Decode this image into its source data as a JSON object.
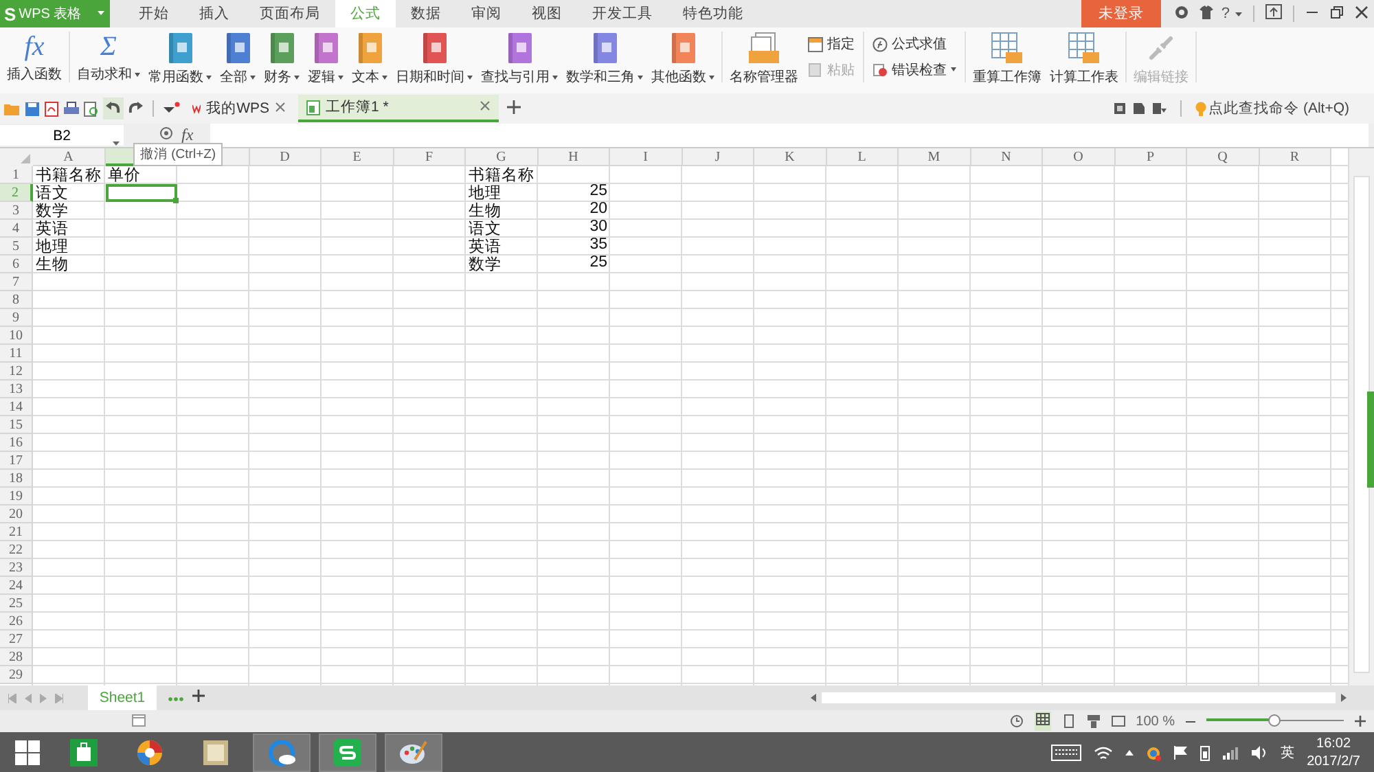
{
  "app_button": {
    "logo": "S",
    "label": "WPS 表格"
  },
  "menu_tabs": [
    {
      "label": "开始",
      "selected": false
    },
    {
      "label": "插入",
      "selected": false
    },
    {
      "label": "页面布局",
      "selected": false
    },
    {
      "label": "公式",
      "selected": true
    },
    {
      "label": "数据",
      "selected": false
    },
    {
      "label": "审阅",
      "selected": false
    },
    {
      "label": "视图",
      "selected": false
    },
    {
      "label": "开发工具",
      "selected": false
    },
    {
      "label": "特色功能",
      "selected": false
    }
  ],
  "login_button": "未登录",
  "help_label": "?",
  "ribbon_groups": [
    [
      {
        "kind": "glyph",
        "glyph": "fx",
        "label": "插入函数",
        "dropdown": false,
        "disabled": false
      }
    ],
    [
      {
        "kind": "glyph",
        "glyph": "Σ",
        "label": "自动求和",
        "dropdown": true,
        "disabled": false
      },
      {
        "kind": "book",
        "color": "#3f9fcf",
        "label": "常用函数",
        "dropdown": true,
        "disabled": false
      },
      {
        "kind": "book",
        "color": "#4f7fd3",
        "label": "全部",
        "dropdown": true,
        "disabled": false
      },
      {
        "kind": "book",
        "color": "#5c9e5c",
        "label": "财务",
        "dropdown": true,
        "disabled": false
      },
      {
        "kind": "book",
        "color": "#c274cc",
        "label": "逻辑",
        "dropdown": true,
        "disabled": false
      },
      {
        "kind": "book",
        "color": "#f0a23e",
        "label": "文本",
        "dropdown": true,
        "disabled": false
      },
      {
        "kind": "book",
        "color": "#e05454",
        "label": "日期和时间",
        "dropdown": true,
        "disabled": false
      },
      {
        "kind": "book",
        "color": "#b174dc",
        "label": "查找与引用",
        "dropdown": true,
        "disabled": false
      },
      {
        "kind": "book",
        "color": "#8487e2",
        "label": "数学和三角",
        "dropdown": true,
        "disabled": false
      },
      {
        "kind": "book",
        "color": "#f2845a",
        "label": "其他函数",
        "dropdown": true,
        "disabled": false
      }
    ],
    [
      {
        "kind": "names",
        "label": "名称管理器",
        "dropdown": false,
        "disabled": false
      },
      {
        "kind": "pair",
        "items": [
          {
            "label": "指定",
            "dropdown": false,
            "disabled": false
          },
          {
            "label": "粘贴",
            "dropdown": false,
            "disabled": true
          }
        ]
      }
    ],
    [
      {
        "kind": "pair",
        "items": [
          {
            "label": "公式求值",
            "dropdown": false,
            "disabled": false
          },
          {
            "label": "错误检查",
            "dropdown": true,
            "disabled": false
          }
        ]
      }
    ],
    [
      {
        "kind": "calc",
        "label": "重算工作簿",
        "dropdown": false,
        "disabled": false
      },
      {
        "kind": "calc",
        "label": "计算工作表",
        "dropdown": false,
        "disabled": false
      }
    ],
    [
      {
        "kind": "link",
        "label": "编辑链接",
        "dropdown": false,
        "disabled": true
      }
    ]
  ],
  "doc_tabs": [
    {
      "kind": "home",
      "label": "我的WPS",
      "selected": false
    },
    {
      "kind": "sheet",
      "label": "工作簿1 *",
      "selected": true
    }
  ],
  "command_search": "点此查找命令 (Alt+Q)",
  "formula_bar": {
    "name_box": "B2",
    "fx": "fx"
  },
  "tooltip": "撤消 (Ctrl+Z)",
  "grid": {
    "columns": [
      {
        "letter": "A",
        "selected": false
      },
      {
        "selected": true
      },
      {
        "selected": false
      },
      {
        "letter": "D",
        "selected": false
      },
      {
        "letter": "E",
        "selected": false
      },
      {
        "letter": "F",
        "selected": false
      },
      {
        "letter": "G",
        "selected": false
      },
      {
        "letter": "H",
        "selected": false
      },
      {
        "letter": "I",
        "selected": false
      },
      {
        "letter": "J",
        "selected": false
      },
      {
        "letter": "K",
        "selected": false
      },
      {
        "letter": "L",
        "selected": false
      },
      {
        "letter": "M",
        "selected": false
      },
      {
        "letter": "N",
        "selected": false
      },
      {
        "letter": "O",
        "selected": false
      },
      {
        "letter": "P",
        "selected": false
      },
      {
        "letter": "Q",
        "selected": false
      },
      {
        "letter": "R",
        "selected": false
      }
    ],
    "rows": [
      {
        "number": "1",
        "selected": false,
        "cells": {
          "A": {
            "text": "书籍名称",
            "selected": false
          },
          "B": {
            "text": "单价",
            "selected": false
          },
          "G": {
            "text": "书籍名称",
            "selected": false
          }
        }
      },
      {
        "number": "2",
        "selected": true,
        "cells": {
          "A": {
            "text": "语文",
            "selected": false
          },
          "B": {
            "selected": true
          },
          "G": {
            "text": "地理",
            "selected": false
          },
          "H": {
            "kind": "number",
            "text": "25",
            "selected": false
          }
        }
      },
      {
        "number": "3",
        "selected": false,
        "cells": {
          "A": {
            "text": "数学",
            "selected": false
          },
          "G": {
            "text": "生物",
            "selected": false
          },
          "H": {
            "kind": "number",
            "text": "20",
            "selected": false
          }
        }
      },
      {
        "number": "4",
        "selected": false,
        "cells": {
          "A": {
            "text": "英语",
            "selected": false
          },
          "G": {
            "text": "语文",
            "selected": false
          },
          "H": {
            "kind": "number",
            "text": "30",
            "selected": false
          }
        }
      },
      {
        "number": "5",
        "selected": false,
        "cells": {
          "A": {
            "text": "地理",
            "selected": false
          },
          "G": {
            "text": "英语",
            "selected": false
          },
          "H": {
            "kind": "number",
            "text": "35",
            "selected": false
          }
        }
      },
      {
        "number": "6",
        "selected": false,
        "cells": {
          "A": {
            "text": "生物",
            "selected": false
          },
          "G": {
            "text": "数学",
            "selected": false
          },
          "H": {
            "kind": "number",
            "text": "25",
            "selected": false
          }
        }
      },
      {
        "number": "7",
        "selected": false
      },
      {
        "number": "8",
        "selected": false
      },
      {
        "number": "9",
        "selected": false
      },
      {
        "number": "10",
        "selected": false
      },
      {
        "number": "11",
        "selected": false
      },
      {
        "number": "12",
        "selected": false
      },
      {
        "number": "13",
        "selected": false
      },
      {
        "number": "14",
        "selected": false
      },
      {
        "number": "15",
        "selected": false
      },
      {
        "number": "16",
        "selected": false
      },
      {
        "number": "17",
        "selected": false
      },
      {
        "number": "18",
        "selected": false
      },
      {
        "number": "19",
        "selected": false
      },
      {
        "number": "20",
        "selected": false
      },
      {
        "number": "21",
        "selected": false
      },
      {
        "number": "22",
        "selected": false
      },
      {
        "number": "23",
        "selected": false
      },
      {
        "number": "24",
        "selected": false
      },
      {
        "number": "25",
        "selected": false
      },
      {
        "number": "26",
        "selected": false
      },
      {
        "number": "27",
        "selected": false
      },
      {
        "number": "28",
        "selected": false
      },
      {
        "number": "29",
        "selected": false
      }
    ]
  },
  "sheet_tabs": [
    {
      "label": "Sheet1",
      "selected": true
    }
  ],
  "status_bar": {
    "zoom": "100 %",
    "zoom_slider": {
      "level": 0.5
    }
  },
  "taskbar": {
    "apps": [
      {
        "kind": "store",
        "active": false
      },
      {
        "kind": "orb",
        "active": false
      },
      {
        "kind": "notes",
        "active": false
      },
      {
        "kind": "browser",
        "active": true
      },
      {
        "kind": "wps",
        "active": true
      },
      {
        "kind": "paint",
        "active": true
      }
    ],
    "ime": "英",
    "time": "16:02",
    "date": "2017/2/7"
  }
}
